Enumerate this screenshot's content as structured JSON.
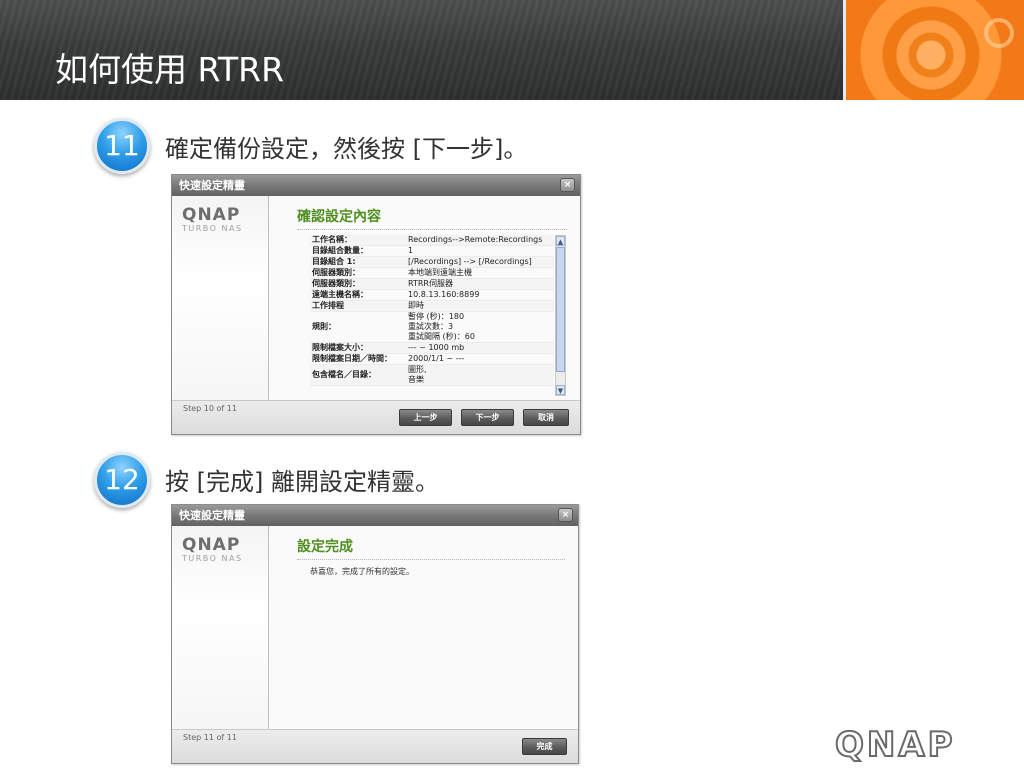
{
  "slide": {
    "title": "如何使用 RTRR",
    "logo": "QNAP"
  },
  "steps": [
    {
      "number": "11",
      "text": "確定備份設定，然後按 [下一步]。"
    },
    {
      "number": "12",
      "text": "按 [完成] 離開設定精靈。"
    }
  ],
  "dialog1": {
    "title": "快速設定精靈",
    "close_icon": "close-icon",
    "brand": "QNAP",
    "brand_sub": "TURBO NAS",
    "heading": "確認設定內容",
    "rows": [
      {
        "key": "工作名稱：",
        "value": "Recordings-->Remote:Recordings"
      },
      {
        "key": "目錄組合數量：",
        "value": "1"
      },
      {
        "key": "目錄組合 1:",
        "value": "[/Recordings] --> [/Recordings]"
      },
      {
        "key": "伺服器類別：",
        "value": "本地端到遠端主機"
      },
      {
        "key": "伺服器類別：",
        "value": "RTRR伺服器"
      },
      {
        "key": "遠端主機名稱：",
        "value": "10.8.13.160:8899"
      },
      {
        "key": "工作排程",
        "value": "即時"
      },
      {
        "key": "規則：",
        "value": "暫停 (秒)：180\n重試次數：3\n重試間隔 (秒)：60"
      },
      {
        "key": "限制檔案大小：",
        "value": "--- ~ 1000 mb"
      },
      {
        "key": "限制檔案日期／時間：",
        "value": "2000/1/1 ~ ---"
      },
      {
        "key": "包含檔名／目錄：",
        "value": "圖形,\n音樂"
      }
    ],
    "footer_step": "Step 10 of 11",
    "buttons": {
      "back": "上一步",
      "next": "下一步",
      "cancel": "取消"
    }
  },
  "dialog2": {
    "title": "快速設定精靈",
    "close_icon": "close-icon",
    "brand": "QNAP",
    "brand_sub": "TURBO NAS",
    "heading": "設定完成",
    "message": "恭喜您，完成了所有的設定。",
    "footer_step": "Step 11 of 11",
    "buttons": {
      "finish": "完成"
    }
  }
}
